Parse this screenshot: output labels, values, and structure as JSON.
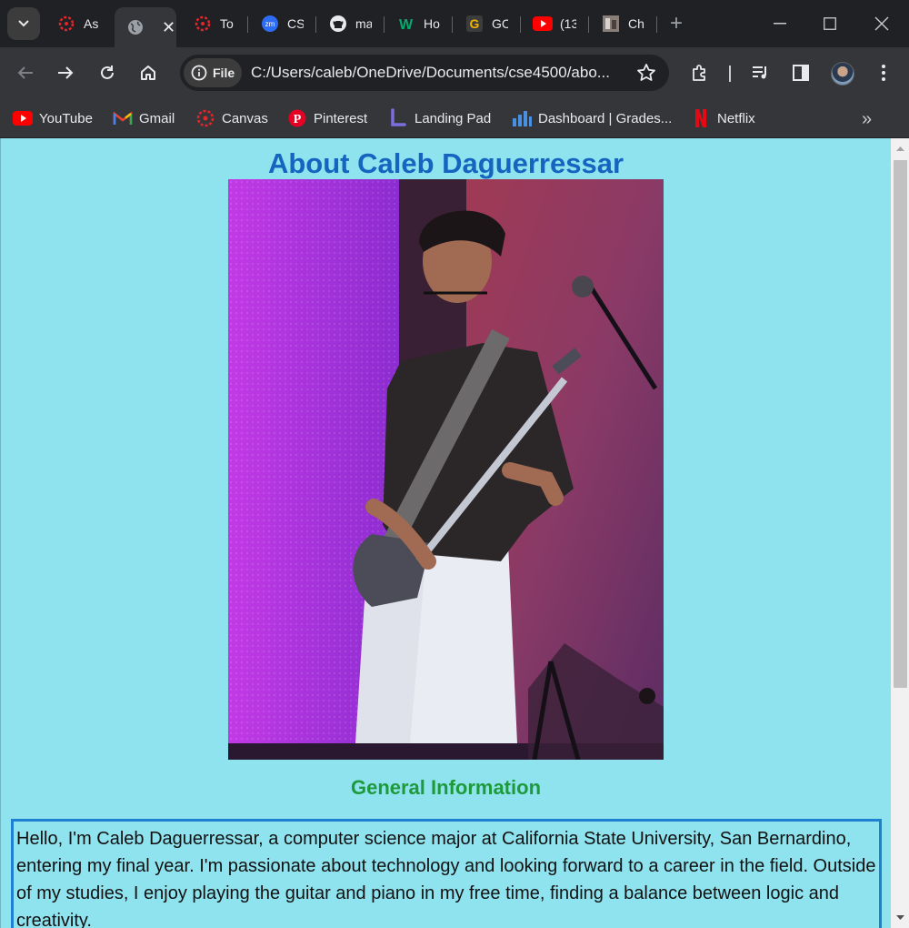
{
  "browser": {
    "tabs": [
      {
        "title": "As",
        "icon": "canvas-icon",
        "active": false
      },
      {
        "title": "",
        "icon": "globe-icon",
        "active": true
      },
      {
        "title": "To",
        "icon": "canvas-icon",
        "active": false
      },
      {
        "title": "CS",
        "icon": "zoom-icon",
        "active": false
      },
      {
        "title": "ma",
        "icon": "github-icon",
        "active": false
      },
      {
        "title": "Ho",
        "icon": "w3schools-icon",
        "active": false
      },
      {
        "title": "GC",
        "icon": "google-icon",
        "active": false
      },
      {
        "title": "(13",
        "icon": "youtube-icon",
        "active": false
      },
      {
        "title": "Ch",
        "icon": "photo-icon",
        "active": false
      }
    ],
    "address": {
      "chip_label": "File",
      "url": "C:/Users/caleb/OneDrive/Documents/cse4500/abo..."
    },
    "bookmarks": [
      {
        "label": "YouTube",
        "icon": "youtube-icon"
      },
      {
        "label": "Gmail",
        "icon": "gmail-icon"
      },
      {
        "label": "Canvas",
        "icon": "canvas-icon"
      },
      {
        "label": "Pinterest",
        "icon": "pinterest-icon"
      },
      {
        "label": "Landing Pad",
        "icon": "landing-pad-icon"
      },
      {
        "label": "Dashboard | Grades...",
        "icon": "dashboard-icon"
      },
      {
        "label": "Netflix",
        "icon": "netflix-icon"
      }
    ]
  },
  "page": {
    "title": "About Caleb Daguerressar",
    "section_heading": "General Information",
    "info_text": "Hello, I'm Caleb Daguerressar, a computer science major at California State University, San Bernardino, entering my final year. I'm passionate about technology and looking forward to a career in the field. Outside of my studies, I enjoy playing the guitar and piano in my free time, finding a balance between logic and creativity.",
    "colors": {
      "background": "#8fe3ee",
      "title": "#1565c0",
      "heading": "#1e9a3c",
      "box_border": "#1f7fd0"
    }
  }
}
